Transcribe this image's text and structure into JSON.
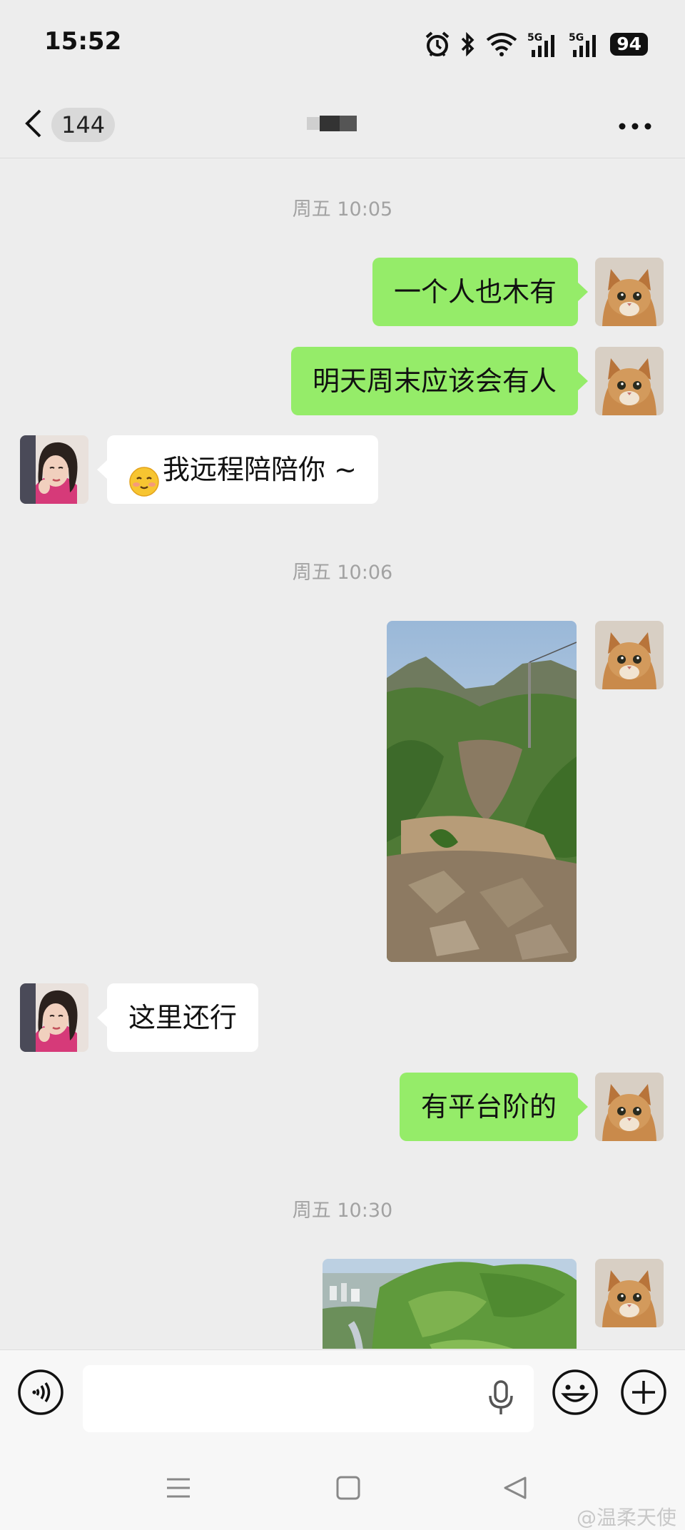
{
  "status": {
    "time": "15:52",
    "network1": "5G",
    "network2": "5G",
    "battery": "94",
    "icons": [
      "alarm-icon",
      "bluetooth-icon",
      "wifi-icon",
      "signal-icon",
      "signal-icon",
      "battery-icon"
    ]
  },
  "header": {
    "back_count": "144",
    "more_label": "···"
  },
  "messages": [
    {
      "type": "timestamp",
      "text": "周五 10:05"
    },
    {
      "type": "text",
      "from": "me",
      "text": "一个人也木有"
    },
    {
      "type": "text",
      "from": "me",
      "text": "明天周末应该会有人"
    },
    {
      "type": "text",
      "from": "them",
      "emoji": "slightly-smiling-blushing-face",
      "text": "我远程陪陪你 ~"
    },
    {
      "type": "timestamp",
      "text": "周五 10:06"
    },
    {
      "type": "image",
      "from": "me",
      "content": "mountain-trail-photo"
    },
    {
      "type": "text",
      "from": "them",
      "text": "这里还行"
    },
    {
      "type": "text",
      "from": "me",
      "text": "有平台阶的"
    },
    {
      "type": "timestamp",
      "text": "周五 10:30"
    },
    {
      "type": "image",
      "from": "me",
      "content": "mountain-view-photo"
    }
  ],
  "input": {
    "placeholder": "",
    "value": ""
  },
  "watermark": "@温柔天使",
  "colors": {
    "background": "#ededed",
    "bubble_me": "#95ec69",
    "bubble_them": "#ffffff",
    "timestamp": "#a2a2a2"
  }
}
